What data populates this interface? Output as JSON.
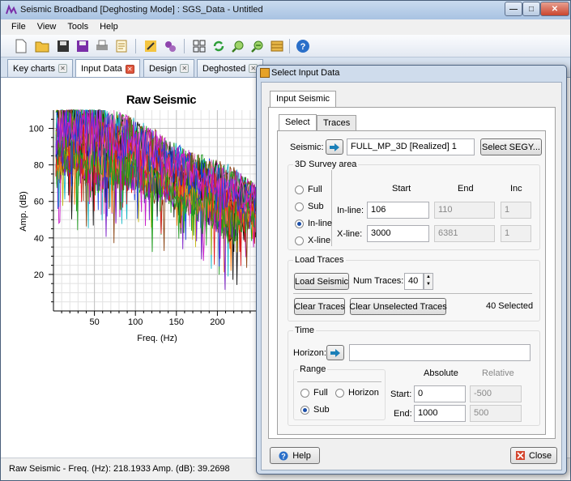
{
  "window": {
    "title": "Seismic Broadband [Deghosting Mode] : SGS_Data - Untitled",
    "minimize": "—",
    "maximize": "□",
    "close": "✕"
  },
  "menu": [
    "File",
    "View",
    "Tools",
    "Help"
  ],
  "toolbar_icons": [
    "new-file-icon",
    "open-folder-icon",
    "save-icon",
    "save-all-icon",
    "print-icon",
    "report-icon",
    "wizard-icon",
    "settings-gears-icon",
    "grid-icon",
    "refresh-icon",
    "zoom-in-icon",
    "zoom-out-icon",
    "layers-icon",
    "help-icon"
  ],
  "tabs": [
    {
      "label": "Key charts"
    },
    {
      "label": "Input Data"
    },
    {
      "label": "Design"
    },
    {
      "label": "Deghosted"
    }
  ],
  "status": {
    "text": "Raw Seismic  -  Freq. (Hz): 218.1933  Amp. (dB): 39.2698"
  },
  "chart_data": {
    "type": "line",
    "title": "Raw Seismic",
    "xlabel": "Freq. (Hz)",
    "ylabel": "Amp. (dB)",
    "xlim": [
      0,
      250
    ],
    "ylim": [
      0,
      110
    ],
    "xticks": [
      50,
      100,
      150,
      200
    ],
    "yticks": [
      20,
      40,
      60,
      80,
      100
    ],
    "grid": true,
    "legend": "none",
    "series_count": 40,
    "envelope": {
      "x": [
        3,
        10,
        20,
        30,
        40,
        50,
        60,
        70,
        80,
        90,
        100,
        110,
        120,
        130,
        140,
        150,
        160,
        170,
        180,
        190,
        200,
        210,
        220,
        230,
        240,
        250
      ],
      "upper": [
        103,
        106,
        106,
        108,
        106,
        105,
        104,
        102,
        101,
        99,
        96,
        94,
        92,
        89,
        86,
        84,
        82,
        80,
        78,
        76,
        74,
        72,
        70,
        68,
        66,
        64
      ],
      "lower": [
        62,
        70,
        72,
        70,
        64,
        60,
        62,
        64,
        66,
        64,
        62,
        60,
        58,
        57,
        55,
        54,
        52,
        50,
        46,
        44,
        40,
        36,
        34,
        40,
        44,
        44
      ]
    },
    "colors": [
      "#e01b1b",
      "#1b9e1b",
      "#1b3de0",
      "#c71bc7",
      "#1bb8c7",
      "#c7b81b",
      "#7a1bc7",
      "#ff7f0e",
      "#111111",
      "#2ca02c",
      "#8b4513",
      "#e377c2"
    ]
  },
  "dialog": {
    "title": "Select Input Data",
    "outer_tab": "Input Seismic",
    "inner_tabs": [
      "Select",
      "Traces"
    ],
    "seismic_label": "Seismic:",
    "seismic_value": "FULL_MP_3D [Realized] 1",
    "select_segy": "Select SEGY...",
    "survey": {
      "title": "3D Survey area",
      "options": [
        "Full",
        "Sub",
        "In-line",
        "X-line"
      ],
      "selected": "In-line",
      "col_start": "Start",
      "col_end": "End",
      "col_inc": "Inc",
      "inline_label": "In-line:",
      "inline_start": "106",
      "inline_end": "110",
      "inline_inc": "1",
      "xline_label": "X-line:",
      "xline_start": "3000",
      "xline_end": "6381",
      "xline_inc": "1"
    },
    "load": {
      "title": "Load Traces",
      "load_button": "Load Seismic",
      "num_label": "Num Traces:",
      "num_value": "40",
      "clear_button": "Clear Traces",
      "clear_unselected_button": "Clear Unselected Traces",
      "selected_text": "40 Selected"
    },
    "time": {
      "title": "Time",
      "horizon_label": "Horizon:",
      "horizon_value": "",
      "range_title": "Range",
      "range_options": [
        "Full",
        "Horizon",
        "Sub"
      ],
      "range_selected": "Sub",
      "col_absolute": "Absolute",
      "col_relative": "Relative",
      "start_label": "Start:",
      "start_abs": "0",
      "start_rel": "-500",
      "end_label": "End:",
      "end_abs": "1000",
      "end_rel": "500"
    },
    "help_button": "Help",
    "close_button": "Close"
  }
}
